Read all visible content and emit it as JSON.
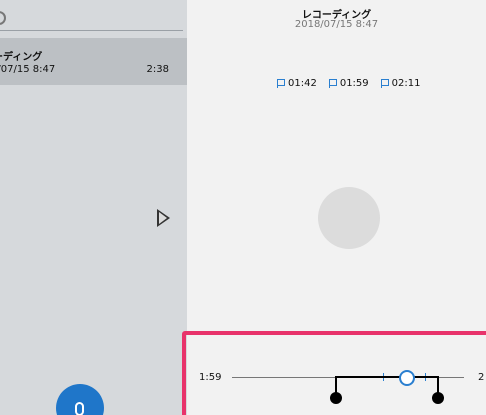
{
  "recordings_list": {
    "items": [
      {
        "title": "ーディング",
        "date": "8/07/15 8:47",
        "duration": "2:38"
      }
    ]
  },
  "detail": {
    "title": "レコーディング",
    "subtitle": "2018/07/15 8:47",
    "markers": [
      "01:42",
      "01:59",
      "02:11"
    ]
  },
  "trim": {
    "start_label": "1:59",
    "end_label": "2"
  },
  "colors": {
    "accent": "#2a7fd0",
    "highlight": "#e8336b",
    "record_button": "#1f76c9"
  }
}
